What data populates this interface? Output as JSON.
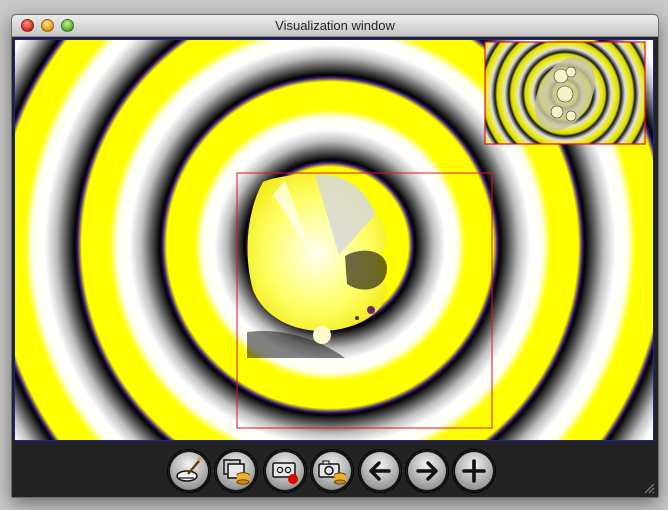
{
  "window": {
    "title": "Visualization window"
  },
  "colors": {
    "ring_yellow": "#ffff00",
    "ring_white": "#ffffff",
    "ring_black": "#000000",
    "ring_edge": "#3a1a7a",
    "selection_border": "#e0102a",
    "canvas_border": "#1a22a8"
  },
  "toolbar": {
    "buttons": [
      {
        "id": "render",
        "icon": "brush-icon"
      },
      {
        "id": "save-layers",
        "icon": "layers-database-icon"
      },
      {
        "id": "record",
        "icon": "tape-record-icon"
      },
      {
        "id": "snapshot",
        "icon": "camera-database-icon"
      },
      {
        "id": "back",
        "icon": "arrow-left-icon"
      },
      {
        "id": "forward",
        "icon": "arrow-right-icon"
      },
      {
        "id": "zoom-in",
        "icon": "plus-icon"
      }
    ]
  }
}
